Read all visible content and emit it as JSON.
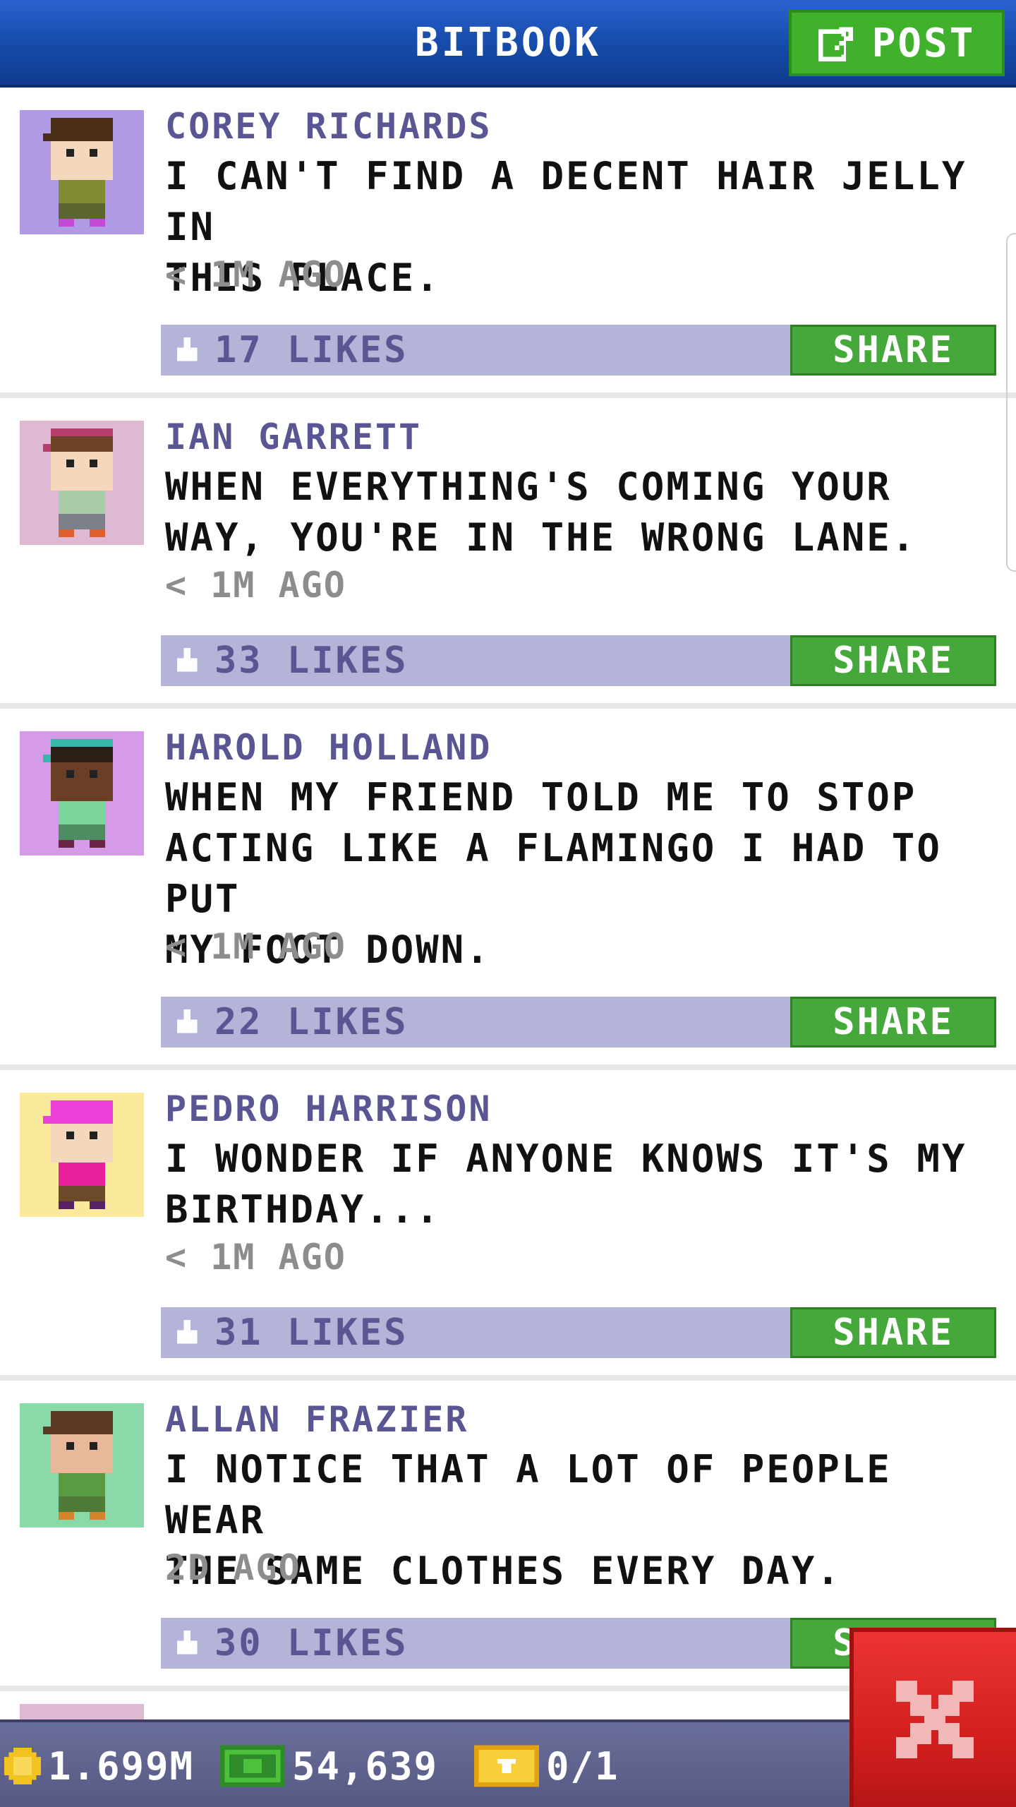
{
  "header": {
    "title": "BITBOOK",
    "post_label": "POST",
    "post_icon": "compose-icon"
  },
  "posts": [
    {
      "author": "COREY RICHARDS",
      "content": "I CAN'T FIND A DECENT HAIR JELLY IN\nTHIS PLACE.",
      "time": "< 1M AGO",
      "likes": "17 LIKES",
      "share_label": "SHARE",
      "avatar_bg": "#b09ae6",
      "hair": "#4a2d17",
      "skin": "#f4d7bc",
      "shirt": "#7f8a32",
      "pants": "#5d6630",
      "shoes": "#c44ad6",
      "hat": ""
    },
    {
      "author": "IAN GARRETT",
      "content": "WHEN EVERYTHING'S COMING YOUR\nWAY, YOU'RE IN THE WRONG LANE.",
      "time": "< 1M AGO",
      "likes": "33 LIKES",
      "share_label": "SHARE",
      "avatar_bg": "#dfb8d4",
      "hair": "#6d4327",
      "skin": "#f4d7bc",
      "shirt": "#a9cba6",
      "pants": "#7a7f88",
      "shoes": "#e0602e",
      "hat": "#b83e6e"
    },
    {
      "author": "HAROLD HOLLAND",
      "content": "WHEN MY FRIEND TOLD ME TO STOP\nACTING LIKE A FLAMINGO I HAD TO PUT\nMY FOOT DOWN.",
      "time": "< 1M AGO",
      "likes": "22 LIKES",
      "share_label": "SHARE",
      "avatar_bg": "#d59be8",
      "hair": "#2c1f18",
      "skin": "#6b3e26",
      "shirt": "#7ad69a",
      "pants": "#4e8c62",
      "shoes": "#6a2444",
      "hat": "#35b8aa"
    },
    {
      "author": "PEDRO HARRISON",
      "content": "I WONDER IF ANYONE KNOWS IT'S MY\nBIRTHDAY...",
      "time": "< 1M AGO",
      "likes": "31 LIKES",
      "share_label": "SHARE",
      "avatar_bg": "#fbe99c",
      "hair": "#ea3fd8",
      "skin": "#f4d7bc",
      "shirt": "#e8209b",
      "pants": "#6b4a2a",
      "shoes": "#5a2266",
      "hat": ""
    },
    {
      "author": "ALLAN FRAZIER",
      "content": "I NOTICE THAT A LOT OF PEOPLE WEAR\nTHE SAME CLOTHES EVERY DAY.",
      "time": "2D AGO",
      "likes": "30 LIKES",
      "share_label": "SHARE",
      "avatar_bg": "#8ad9a8",
      "hair": "#5a3a22",
      "skin": "#e9b79a",
      "shirt": "#5a9a42",
      "pants": "#4f7a38",
      "shoes": "#d6842a",
      "hat": ""
    }
  ],
  "bottom_bar": {
    "coins": "1.699M",
    "bux": "54,639",
    "tickets": "0/1",
    "coin_icon": "coin-icon",
    "bux_icon": "bux-icon",
    "ticket_icon": "ticket-icon",
    "close_icon": "close-icon"
  },
  "colors": {
    "header_blue": "#154aa8",
    "share_green": "#45a83a",
    "likes_bar": "#b3b4d8",
    "author_purple": "#5a5693",
    "close_red": "#d41f1f"
  }
}
